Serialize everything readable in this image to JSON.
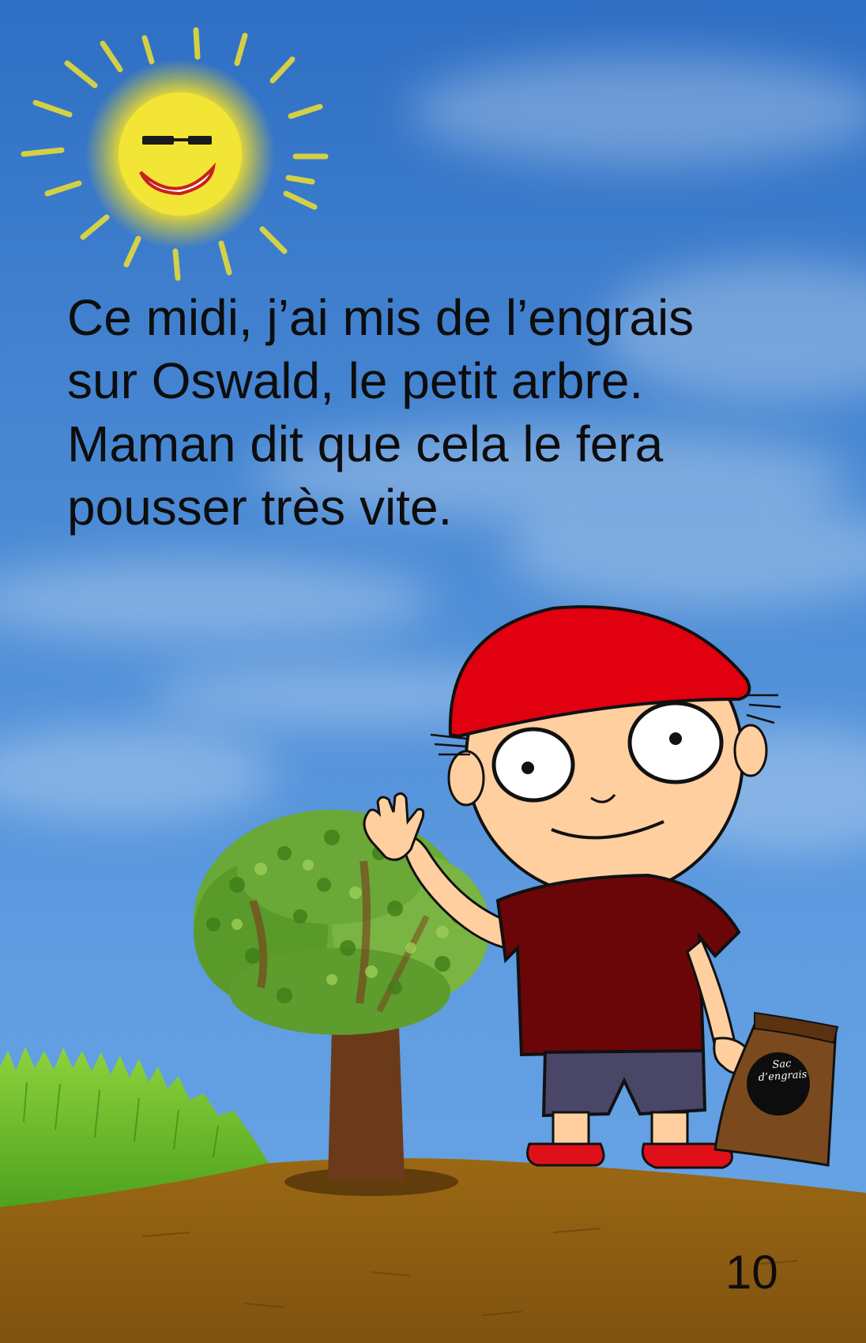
{
  "story": {
    "lines": [
      "Ce midi, j’ai mis de l’engrais",
      "sur Oswald, le petit arbre.",
      "Maman dit que cela le fera",
      "pousser très vite."
    ]
  },
  "page_number": "10",
  "fertilizer_bag": {
    "label_line1": "Sac",
    "label_line2": "d’engrais"
  },
  "colors": {
    "sky": "#4a8ad4",
    "ground": "#8a5a12",
    "cap": "#e0000f",
    "shirt": "#6a0508",
    "shorts": "#4a4668",
    "skin": "#ffcfa0",
    "sun": "#f4e433",
    "foliage": "#5a9a2a",
    "trunk": "#6b3a1a"
  }
}
